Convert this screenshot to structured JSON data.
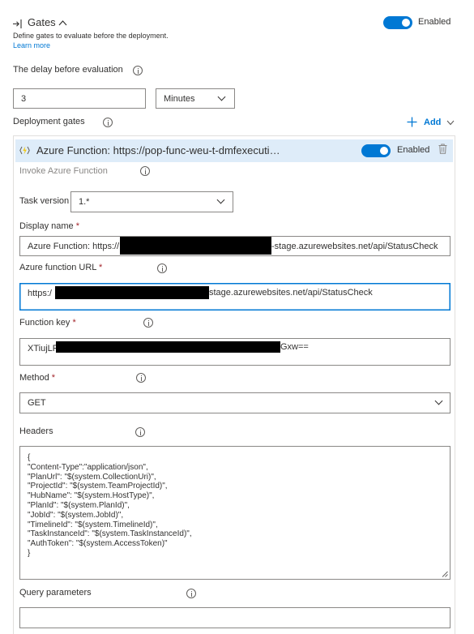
{
  "gates": {
    "title": "Gates",
    "enabled_label": "Enabled",
    "description": "Define gates to evaluate before the deployment.",
    "learn_more": "Learn more"
  },
  "delay": {
    "label": "The delay before evaluation",
    "value": "3",
    "unit": "Minutes"
  },
  "deployment_gates": {
    "label": "Deployment gates",
    "add_label": "Add"
  },
  "gate": {
    "title": "Azure Function: https://pop-func-weu-t-dmfexecuti…",
    "enabled_label": "Enabled",
    "subtitle": "Invoke Azure Function",
    "task_version_label": "Task version",
    "task_version_value": "1.*",
    "display_name_label": "Display name",
    "display_name_prefix": "Azure Function: https://",
    "display_name_suffix": "-stage.azurewebsites.net/api/StatusCheck",
    "function_url_label": "Azure function URL",
    "function_url_prefix": "https:/",
    "function_url_suffix": "stage.azurewebsites.net/api/StatusCheck",
    "function_key_label": "Function key",
    "function_key_prefix": "XTiujLR",
    "function_key_suffix": "Gxw==",
    "method_label": "Method",
    "method_value": "GET",
    "headers_label": "Headers",
    "headers_value": "{\n\"Content-Type\":\"application/json\",\n\"PlanUrl\": \"$(system.CollectionUri)\",\n\"ProjectId\": \"$(system.TeamProjectId)\",\n\"HubName\": \"$(system.HostType)\",\n\"PlanId\": \"$(system.PlanId)\",\n\"JobId\": \"$(system.JobId)\",\n\"TimelineId\": \"$(system.TimelineId)\",\n\"TaskInstanceId\": \"$(system.TaskInstanceId)\",\n\"AuthToken\": \"$(system.AccessToken)\"\n}",
    "query_params_label": "Query parameters",
    "query_params_value": ""
  },
  "colors": {
    "accent": "#0078d4",
    "required": "#a4262c",
    "header_bg": "#deecf9"
  }
}
